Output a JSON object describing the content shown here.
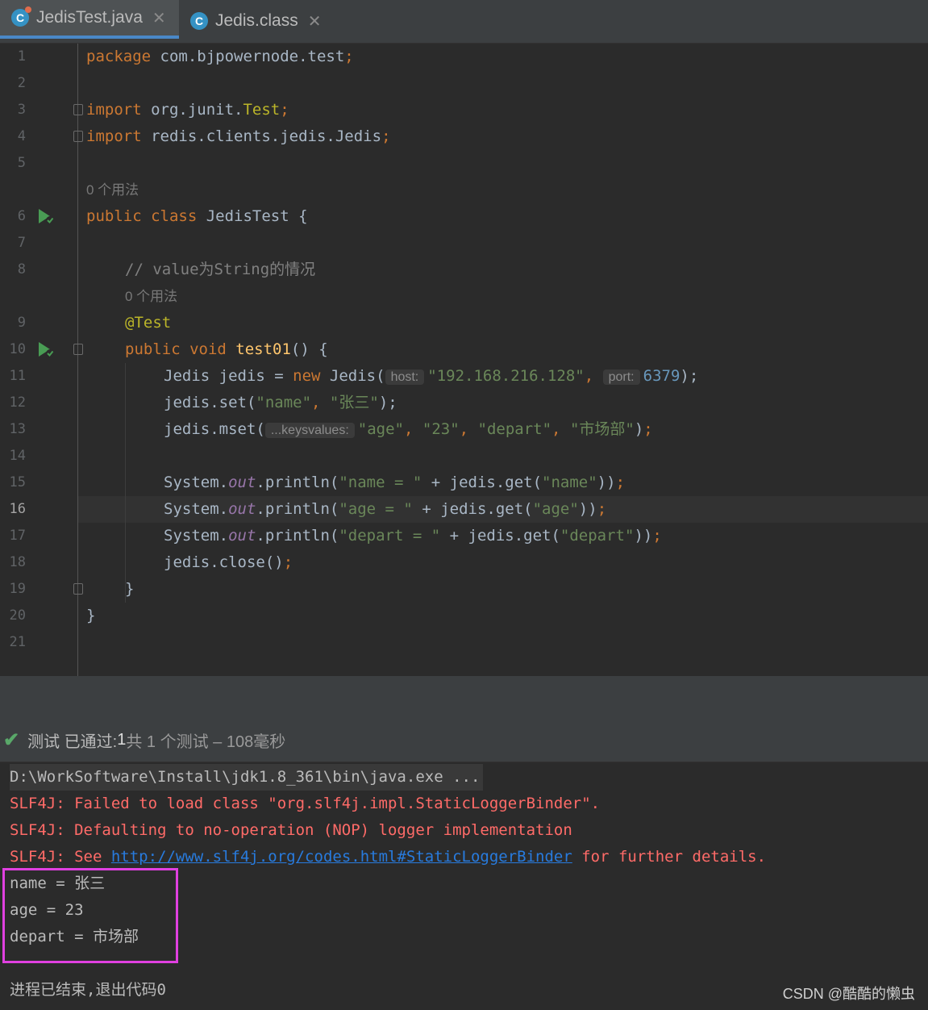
{
  "tabs": [
    {
      "label": "JedisTest.java",
      "active": true
    },
    {
      "label": "Jedis.class",
      "active": false
    }
  ],
  "editor": {
    "line_numbers": [
      "1",
      "2",
      "3",
      "4",
      "5",
      "6",
      "7",
      "8",
      "9",
      "10",
      "11",
      "12",
      "13",
      "14",
      "15",
      "16",
      "17",
      "18",
      "19",
      "20",
      "21"
    ],
    "current_line": "16",
    "usage_hint": "0 个用法",
    "lines": {
      "l1_kw": "package",
      "l1_rest": " com.bjpowernode.test",
      "l3_kw": "import",
      "l3_pkg": " org.junit.",
      "l3_cls": "Test",
      "l4_kw": "import",
      "l4_rest": " redis.clients.jedis.Jedis",
      "l6_kw": "public class",
      "l6_rest": " JedisTest {",
      "l8_comment": "// value为String的情况",
      "l9_ann": "@Test",
      "l10_kw": "public void",
      "l10_fn": " test01",
      "l10_rest": "() {",
      "l11_a": "Jedis jedis = ",
      "l11_new": "new",
      "l11_b": " Jedis(",
      "l11_hint_host": "host:",
      "l11_str": "\"192.168.216.128\"",
      "l11_comma": ", ",
      "l11_hint_port": "port:",
      "l11_num": "6379",
      "l11_end": ");",
      "l12_a": "jedis.set(",
      "l12_s1": "\"name\"",
      "l12_s2": "\"张三\"",
      "l12_end": ");",
      "l13_a": "jedis.mset(",
      "l13_hint": "...keysvalues:",
      "l13_s1": "\"age\"",
      "l13_s2": "\"23\"",
      "l13_s3": "\"depart\"",
      "l13_s4": "\"市场部\"",
      "l15_s": "\"name = \"",
      "l15_k": "\"name\"",
      "l16_s": "\"age = \"",
      "l16_k": "\"age\"",
      "l17_s": "\"depart = \"",
      "l17_k": "\"depart\"",
      "sys": "System.",
      "out": "out",
      "println": ".println(",
      "plus_get": " + jedis.get(",
      "close_paren": "))",
      "l18": "jedis.close()",
      "close_brace": "}"
    }
  },
  "test_status": {
    "text_a": "测试 已通过: ",
    "passed": "1",
    "text_b": "共 1 个测试 – 108毫秒"
  },
  "console": {
    "cmd": "D:\\WorkSoftware\\Install\\jdk1.8_361\\bin\\java.exe ...",
    "err1": "SLF4J: Failed to load class \"org.slf4j.impl.StaticLoggerBinder\".",
    "err2": "SLF4J: Defaulting to no-operation (NOP) logger implementation",
    "err3_a": "SLF4J: See ",
    "err3_link": "http://www.slf4j.org/codes.html#StaticLoggerBinder",
    "err3_b": " for further details.",
    "out1": "name = 张三",
    "out2": "age = 23",
    "out3": "depart = 市场部",
    "exit": "进程已结束,退出代码0"
  },
  "watermark": "CSDN @酷酷的懒虫"
}
